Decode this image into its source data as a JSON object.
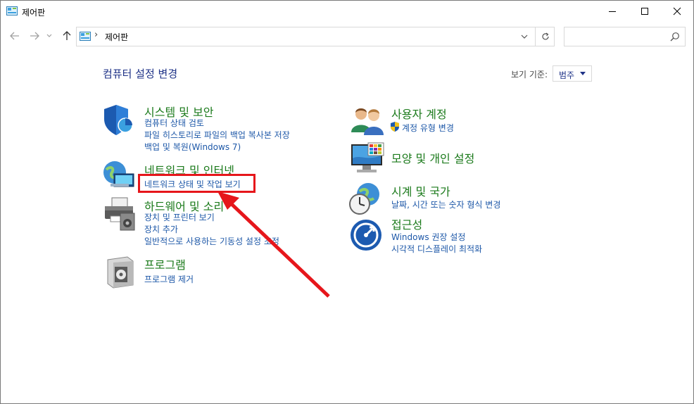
{
  "window": {
    "title": "제어판"
  },
  "address": {
    "path": "제어판",
    "search_placeholder": ""
  },
  "header": {
    "title": "컴퓨터 설정 변경",
    "viewby_label": "보기 기준:",
    "viewby_value": "범주"
  },
  "categories": [
    {
      "title": "시스템 및 보안",
      "icon": "shield-icon",
      "links": [
        "컴퓨터 상태 검토",
        "파일 히스토리로 파일의 백업 복사본 저장",
        "백업 및 복원(Windows 7)"
      ]
    },
    {
      "title": "네트워크 및 인터넷",
      "icon": "network-icon",
      "links": [
        "네트워크 상태 및 작업 보기"
      ]
    },
    {
      "title": "하드웨어 및 소리",
      "icon": "printer-icon",
      "links": [
        "장치 및 프린터 보기",
        "장치 추가",
        "일반적으로 사용하는 기동성 설정 조정"
      ]
    },
    {
      "title": "프로그램",
      "icon": "programs-icon",
      "links": [
        "프로그램 제거"
      ]
    },
    {
      "title": "사용자 계정",
      "icon": "users-icon",
      "links": [
        "계정 유형 변경"
      ]
    },
    {
      "title": "모양 및 개인 설정",
      "icon": "monitor-icon",
      "links": []
    },
    {
      "title": "시계 및 국가",
      "icon": "clock-globe-icon",
      "links": [
        "날짜, 시간 또는 숫자 형식 변경"
      ]
    },
    {
      "title": "접근성",
      "icon": "accessibility-icon",
      "links": [
        "Windows 권장 설정",
        "시각적 디스플레이 최적화"
      ]
    }
  ],
  "annotation": {
    "color": "#e6161b",
    "highlight_target": "네트워크 상태 및 작업 보기"
  },
  "colors": {
    "category_title": "#1b7a1b",
    "link": "#1e58a8",
    "page_title": "#1e3287"
  }
}
